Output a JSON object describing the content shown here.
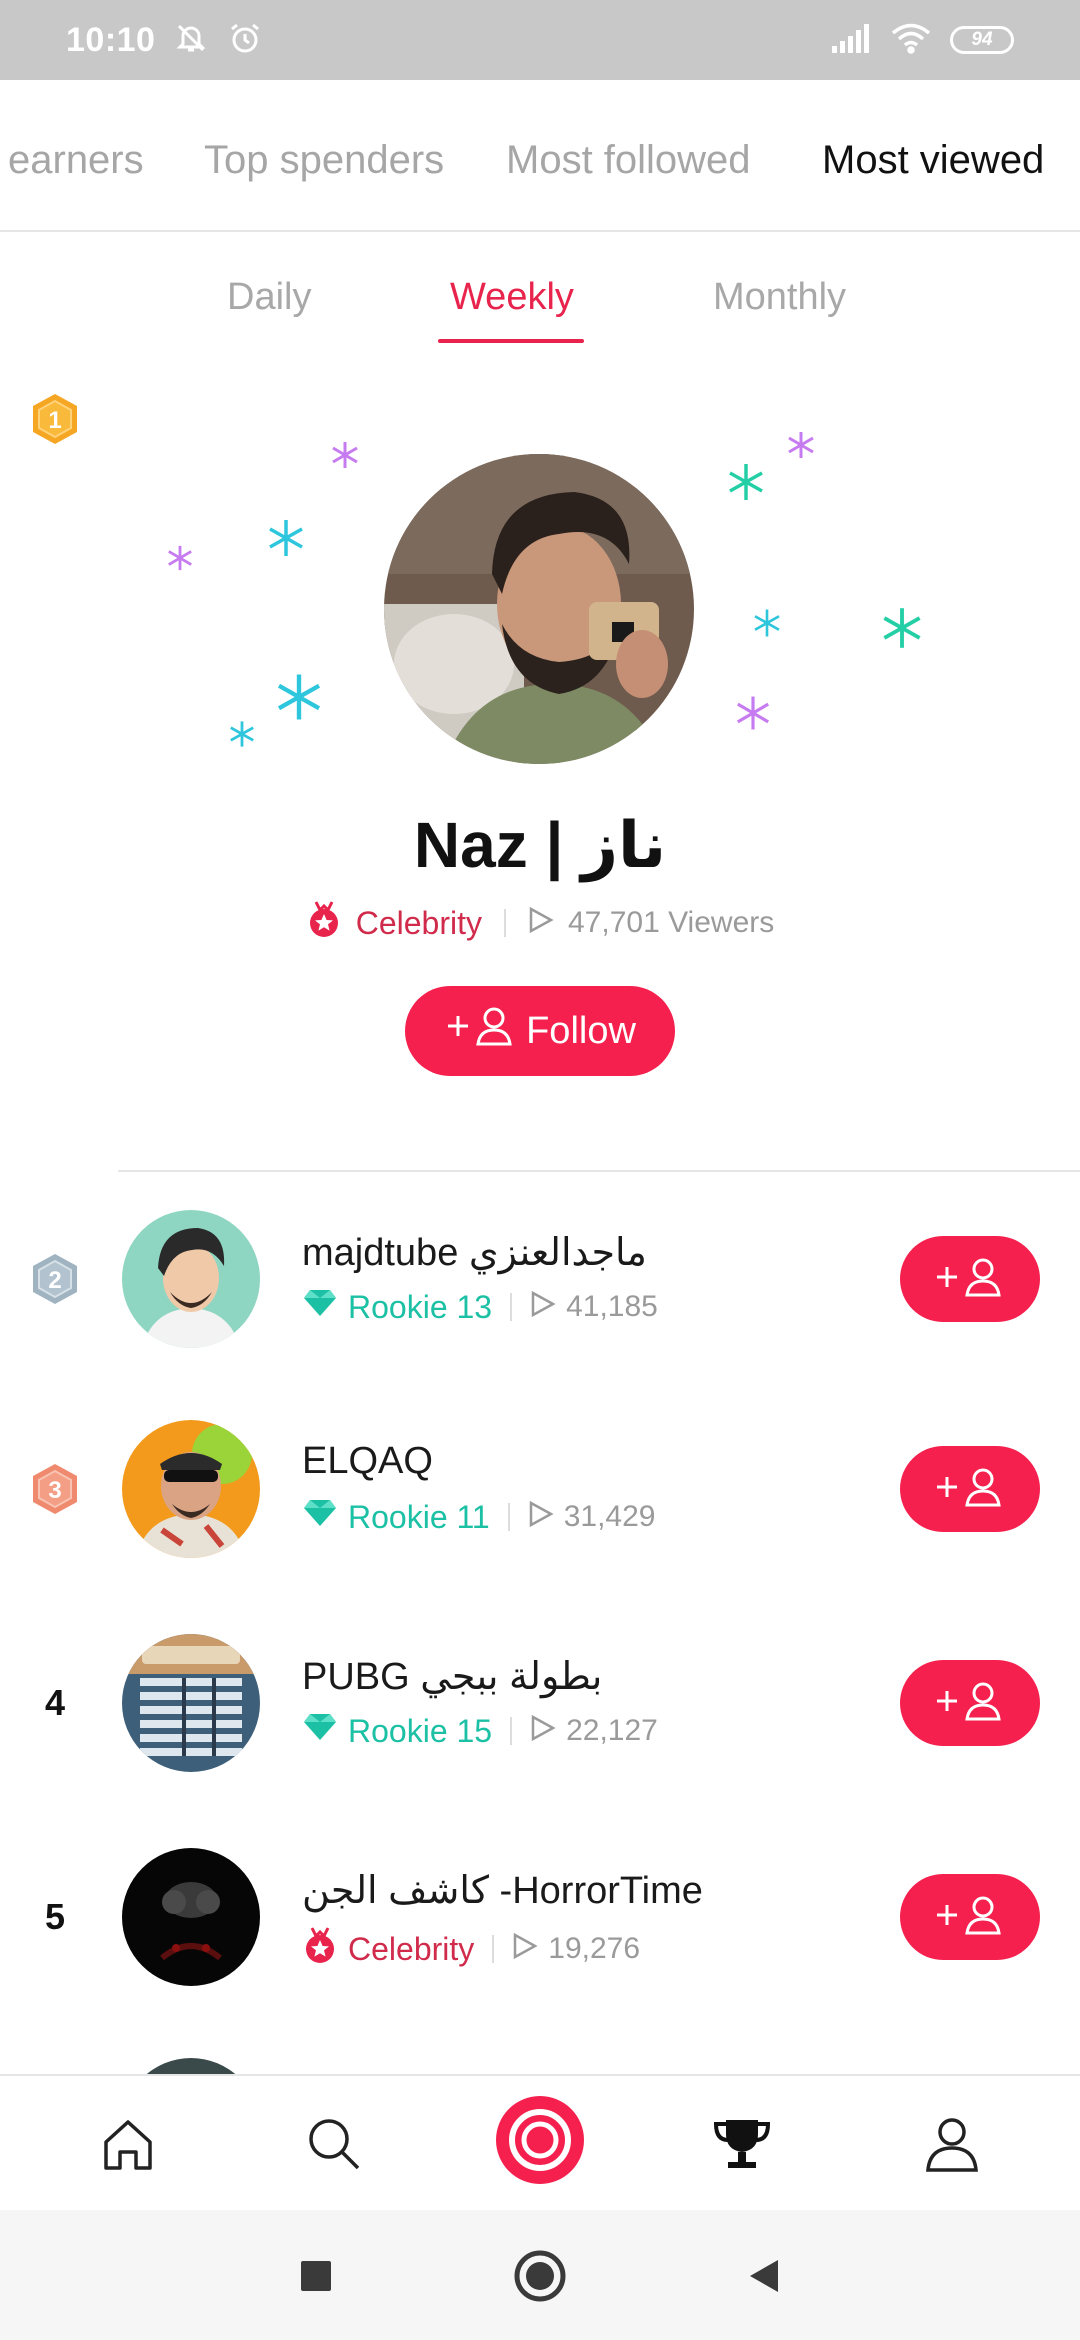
{
  "status_bar": {
    "time": "10:10",
    "battery": "94",
    "icons": [
      "mute-icon",
      "alarm-icon",
      "signal-icon",
      "wifi-icon",
      "battery-icon"
    ]
  },
  "top_tabs": [
    {
      "label": "earners",
      "active": false
    },
    {
      "label": "Top spenders",
      "active": false
    },
    {
      "label": "Most followed",
      "active": false
    },
    {
      "label": "Most viewed",
      "active": true
    }
  ],
  "period_tabs": [
    {
      "label": "Daily",
      "active": false
    },
    {
      "label": "Weekly",
      "active": true
    },
    {
      "label": "Monthly",
      "active": false
    }
  ],
  "hero": {
    "rank": "1",
    "name": "Naz | ناز",
    "badge": "Celebrity",
    "views": "47,701 Viewers",
    "follow_label": "Follow"
  },
  "leaderboard": [
    {
      "rank": "2",
      "name": "majdtube ماجدالعنزي",
      "level": "Rookie 13",
      "level_type": "rookie",
      "views": "41,185"
    },
    {
      "rank": "3",
      "name": "ELQAQ",
      "level": "Rookie 11",
      "level_type": "rookie",
      "views": "31,429"
    },
    {
      "rank": "4",
      "name": "PUBG بطولة ببجي",
      "level": "Rookie 15",
      "level_type": "rookie",
      "views": "22,127"
    },
    {
      "rank": "5",
      "name": "كاشف الجن -HorrorTime",
      "level": "Celebrity",
      "level_type": "celebrity",
      "views": "19,276"
    }
  ],
  "bottom_nav": [
    "home-icon",
    "search-icon",
    "live-icon",
    "trophy-icon",
    "profile-icon"
  ],
  "colors": {
    "accent": "#f5204e",
    "celebrity": "#d12b4c",
    "rookie": "#1cc0a4",
    "muted": "#a6a6a6",
    "gold": "#f5a623",
    "silver": "#9fb3c1",
    "bronze": "#ef8a6e"
  }
}
